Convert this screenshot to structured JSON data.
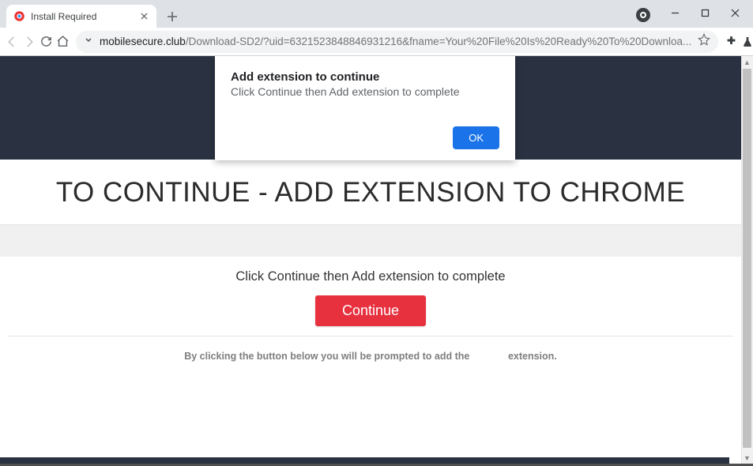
{
  "window": {
    "tab_title": "Install Required"
  },
  "toolbar": {
    "url_domain": "mobilesecure.club",
    "url_path": "/Download-SD2/?uid=6321523848846931216&fname=Your%20File%20Is%20Ready%20To%20Downloa..."
  },
  "dialog": {
    "title": "Add extension to continue",
    "body": "Click Continue then Add extension to complete",
    "ok": "OK"
  },
  "page": {
    "heading": "TO CONTINUE - ADD EXTENSION TO CHROME",
    "instruction": "Click Continue then Add extension to complete",
    "continue_label": "Continue",
    "fineprint_before": "By clicking the button below you will be prompted to add the",
    "fineprint_after": "extension."
  }
}
